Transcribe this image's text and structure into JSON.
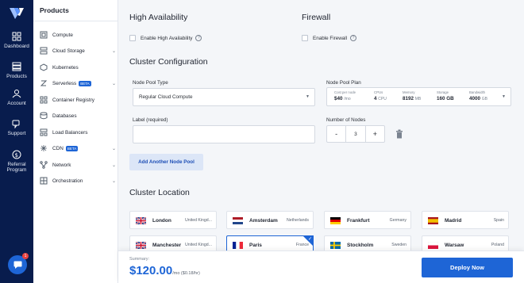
{
  "rail": {
    "items": [
      {
        "label": "Dashboard",
        "icon": "dashboard-icon"
      },
      {
        "label": "Products",
        "icon": "products-icon"
      },
      {
        "label": "Account",
        "icon": "account-icon"
      },
      {
        "label": "Support",
        "icon": "support-icon"
      },
      {
        "label": "Referral",
        "label2": "Program",
        "icon": "referral-icon"
      }
    ],
    "chat_badge": "1"
  },
  "sidebar": {
    "title": "Products",
    "items": [
      {
        "label": "Compute",
        "icon": "compute-icon"
      },
      {
        "label": "Cloud Storage",
        "icon": "storage-icon"
      },
      {
        "label": "Kubernetes",
        "icon": "kubernetes-icon"
      },
      {
        "label": "Serverless",
        "badge": "BETA",
        "icon": "serverless-icon"
      },
      {
        "label": "Container Registry",
        "icon": "registry-icon"
      },
      {
        "label": "Databases",
        "icon": "database-icon"
      },
      {
        "label": "Load Balancers",
        "icon": "load-balancer-icon"
      },
      {
        "label": "CDN",
        "badge": "BETA",
        "icon": "cdn-icon"
      },
      {
        "label": "Network",
        "icon": "network-icon"
      },
      {
        "label": "Orchestration",
        "icon": "orchestration-icon"
      }
    ]
  },
  "ha": {
    "title": "High Availability",
    "checkbox": "Enable High Availability"
  },
  "firewall": {
    "title": "Firewall",
    "checkbox": "Enable Firewall"
  },
  "cluster": {
    "title": "Cluster Configuration",
    "pool_type_label": "Node Pool Type",
    "pool_type_value": "Regular Cloud Compute",
    "plan_label": "Node Pool Plan",
    "plan": {
      "cost_k": "Cost per node",
      "cost_v": "$40",
      "cost_u": "/mo",
      "cpu_k": "CPUs",
      "cpu_v": "4",
      "cpu_u": "CPU",
      "mem_k": "Memory",
      "mem_v": "8192",
      "mem_u": "MB",
      "sto_k": "Storage",
      "sto_v": "160 GB",
      "bw_k": "Bandwidth",
      "bw_v": "4000",
      "bw_u": "GB"
    },
    "label_label": "Label (required)",
    "label_value": "",
    "nodes_label": "Number of Nodes",
    "nodes_minus": "-",
    "nodes_value": "3",
    "nodes_plus": "+",
    "add_pool": "Add Another Node Pool"
  },
  "location": {
    "title": "Cluster Location",
    "items": [
      {
        "city": "London",
        "country": "United Kingd...",
        "flag": "uk"
      },
      {
        "city": "Amsterdam",
        "country": "Netherlands",
        "flag": "nl"
      },
      {
        "city": "Frankfurt",
        "country": "Germany",
        "flag": "de"
      },
      {
        "city": "Madrid",
        "country": "Spain",
        "flag": "es"
      },
      {
        "city": "Manchester",
        "country": "United Kingd...",
        "flag": "uk"
      },
      {
        "city": "Paris",
        "country": "France",
        "flag": "fr",
        "selected": true
      },
      {
        "city": "Stockholm",
        "country": "Sweden",
        "flag": "se"
      },
      {
        "city": "Warsaw",
        "country": "Poland",
        "flag": "pl"
      }
    ]
  },
  "summary": {
    "label": "Summary:",
    "price": "$120.00",
    "period": "/mo ($0.18/hr)",
    "deploy": "Deploy Now"
  },
  "colors": {
    "accent": "#1e65d6",
    "rail": "#081c4d"
  }
}
